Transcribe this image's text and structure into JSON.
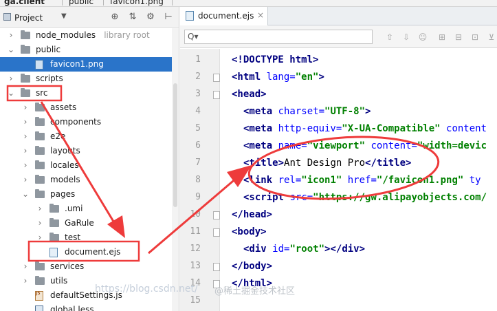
{
  "breadcrumb": [
    "ga.client",
    "public",
    "favicon1.png"
  ],
  "project": {
    "title": "Project",
    "header_icons": [
      "target-icon",
      "collapse-icon",
      "gear-icon",
      "hide-icon"
    ],
    "tree": [
      {
        "depth": 0,
        "name": "node_modules",
        "note": "library root",
        "kind": "folder",
        "expanded": false
      },
      {
        "depth": 0,
        "name": "public",
        "kind": "folder",
        "expanded": true
      },
      {
        "depth": 1,
        "name": "favicon1.png",
        "kind": "img",
        "selected": true
      },
      {
        "depth": 0,
        "name": "scripts",
        "kind": "folder",
        "expanded": false
      },
      {
        "depth": 0,
        "name": "src",
        "kind": "folder",
        "expanded": true,
        "highlighted": true
      },
      {
        "depth": 1,
        "name": "assets",
        "kind": "folder",
        "expanded": false
      },
      {
        "depth": 1,
        "name": "components",
        "kind": "folder",
        "expanded": false
      },
      {
        "depth": 1,
        "name": "e2e",
        "kind": "folder",
        "expanded": false
      },
      {
        "depth": 1,
        "name": "layouts",
        "kind": "folder",
        "expanded": false
      },
      {
        "depth": 1,
        "name": "locales",
        "kind": "folder",
        "expanded": false
      },
      {
        "depth": 1,
        "name": "models",
        "kind": "folder",
        "expanded": false
      },
      {
        "depth": 1,
        "name": "pages",
        "kind": "folder",
        "expanded": true
      },
      {
        "depth": 2,
        "name": ".umi",
        "kind": "folder",
        "expanded": false
      },
      {
        "depth": 2,
        "name": "GaRule",
        "kind": "folder",
        "expanded": false
      },
      {
        "depth": 2,
        "name": "test",
        "kind": "folder",
        "expanded": false
      },
      {
        "depth": 2,
        "name": "document.ejs",
        "kind": "ejs",
        "highlighted": true
      },
      {
        "depth": 1,
        "name": "services",
        "kind": "folder",
        "expanded": false
      },
      {
        "depth": 1,
        "name": "utils",
        "kind": "folder",
        "expanded": false
      },
      {
        "depth": 1,
        "name": "defaultSettings.js",
        "kind": "js"
      },
      {
        "depth": 1,
        "name": "global.less",
        "kind": "css"
      }
    ]
  },
  "editor": {
    "tab_label": "document.ejs",
    "tab_close": "×",
    "search": {
      "value": "",
      "placeholder": "",
      "glyph": "Q▾"
    },
    "search_tools": [
      "arrow-up-icon",
      "arrow-down-icon",
      "find-usages-icon",
      "add-occurrence-icon",
      "remove-occurrence-icon",
      "select-all-icon",
      "filter-icon"
    ],
    "line_numbers": [
      "1",
      "2",
      "3",
      "4",
      "5",
      "6",
      "7",
      "8",
      "9",
      "10",
      "11",
      "12",
      "13",
      "14",
      "15"
    ],
    "code_lines": [
      {
        "indent": 0,
        "tokens": [
          [
            "tag",
            "<!DOCTYPE "
          ],
          [
            "tag",
            "html"
          ],
          [
            "tag",
            ">"
          ]
        ]
      },
      {
        "indent": 0,
        "tokens": [
          [
            "tag",
            "<html "
          ],
          [
            "attr",
            "lang="
          ],
          [
            "val",
            "\"en\""
          ],
          [
            "tag",
            ">"
          ]
        ]
      },
      {
        "indent": 0,
        "tokens": [
          [
            "tag",
            "<head>"
          ]
        ]
      },
      {
        "indent": 1,
        "tokens": [
          [
            "tag",
            "<meta "
          ],
          [
            "attr",
            "charset="
          ],
          [
            "val",
            "\"UTF-8\""
          ],
          [
            "tag",
            ">"
          ]
        ]
      },
      {
        "indent": 1,
        "tokens": [
          [
            "tag",
            "<meta "
          ],
          [
            "attr",
            "http-equiv="
          ],
          [
            "val",
            "\"X-UA-Compatible\""
          ],
          [
            "attr",
            " content"
          ]
        ]
      },
      {
        "indent": 1,
        "tokens": [
          [
            "tag",
            "<meta "
          ],
          [
            "attr",
            "name="
          ],
          [
            "val",
            "\"viewport\""
          ],
          [
            "attr",
            " content="
          ],
          [
            "val",
            "\"width=devic"
          ]
        ]
      },
      {
        "indent": 1,
        "tokens": [
          [
            "tag",
            "<title>"
          ],
          [
            "txt",
            "Ant Design Pro"
          ],
          [
            "tag",
            "</title>"
          ]
        ]
      },
      {
        "indent": 1,
        "tokens": [
          [
            "tag",
            "<link "
          ],
          [
            "attr",
            "rel="
          ],
          [
            "val",
            "\"icon1\""
          ],
          [
            "attr",
            " href="
          ],
          [
            "val",
            "\"/favicon1.png\""
          ],
          [
            "attr",
            " ty"
          ]
        ]
      },
      {
        "indent": 1,
        "tokens": [
          [
            "tag",
            "<script "
          ],
          [
            "attr",
            "src="
          ],
          [
            "val",
            "\"https://gw.alipayobjects.com/"
          ]
        ]
      },
      {
        "indent": 0,
        "tokens": [
          [
            "tag",
            "</head>"
          ]
        ]
      },
      {
        "indent": 0,
        "tokens": [
          [
            "tag",
            "<body>"
          ]
        ]
      },
      {
        "indent": 1,
        "tokens": [
          [
            "tag",
            "<div "
          ],
          [
            "attr",
            "id="
          ],
          [
            "val",
            "\"root\""
          ],
          [
            "tag",
            "></div>"
          ]
        ]
      },
      {
        "indent": 0,
        "tokens": [
          [
            "tag",
            "</body>"
          ]
        ]
      },
      {
        "indent": 0,
        "tokens": [
          [
            "tag",
            "</html>"
          ]
        ]
      },
      {
        "indent": 0,
        "tokens": []
      }
    ]
  },
  "watermark": "https://blog.csdn.net/",
  "watermark_brand": "@稀土掘金技术社区",
  "colors": {
    "selection": "#2a74c9",
    "annotation": "#ee3b3b",
    "tag": "#000080",
    "attr": "#0000ff",
    "value": "#008000"
  }
}
